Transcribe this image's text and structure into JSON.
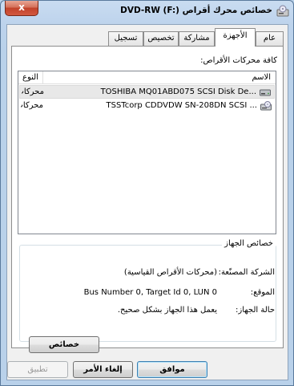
{
  "window": {
    "title": "خصائص محرك أقراص DVD-RW (F:)",
    "close_label": "x"
  },
  "tabs": [
    {
      "label": "عام"
    },
    {
      "label": "الأجهزة"
    },
    {
      "label": "مشاركة"
    },
    {
      "label": "تخصيص"
    },
    {
      "label": "تسجيل"
    }
  ],
  "hardware": {
    "all_drives_label": "كافة محركات الأقراص:",
    "columns": {
      "name": "الاسم",
      "type": "النوع"
    },
    "rows": [
      {
        "name": "TOSHIBA MQ01ABD075 SCSI Disk De...",
        "type": "محركات الأ...",
        "icon": "hard-disk-icon"
      },
      {
        "name": "TSSTcorp CDDVDW SN-208DN SCSI ...",
        "type": "محركات الأ...",
        "icon": "optical-drive-icon"
      }
    ],
    "device_properties": {
      "group_title": "خصائص الجهاز",
      "manufacturer_label": "الشركة المصنّعة:",
      "manufacturer_value": "(محركات الأقراص القياسية)",
      "location_label": "الموقع:",
      "location_value": "Bus Number 0, Target Id 0, LUN 0",
      "status_label": "حالة الجهاز:",
      "status_value": "يعمل هذا الجهاز بشكل صحيح.",
      "properties_button": "خصائص"
    }
  },
  "footer": {
    "ok": "موافق",
    "cancel": "إلغاء الأمر",
    "apply": "تطبيق"
  }
}
